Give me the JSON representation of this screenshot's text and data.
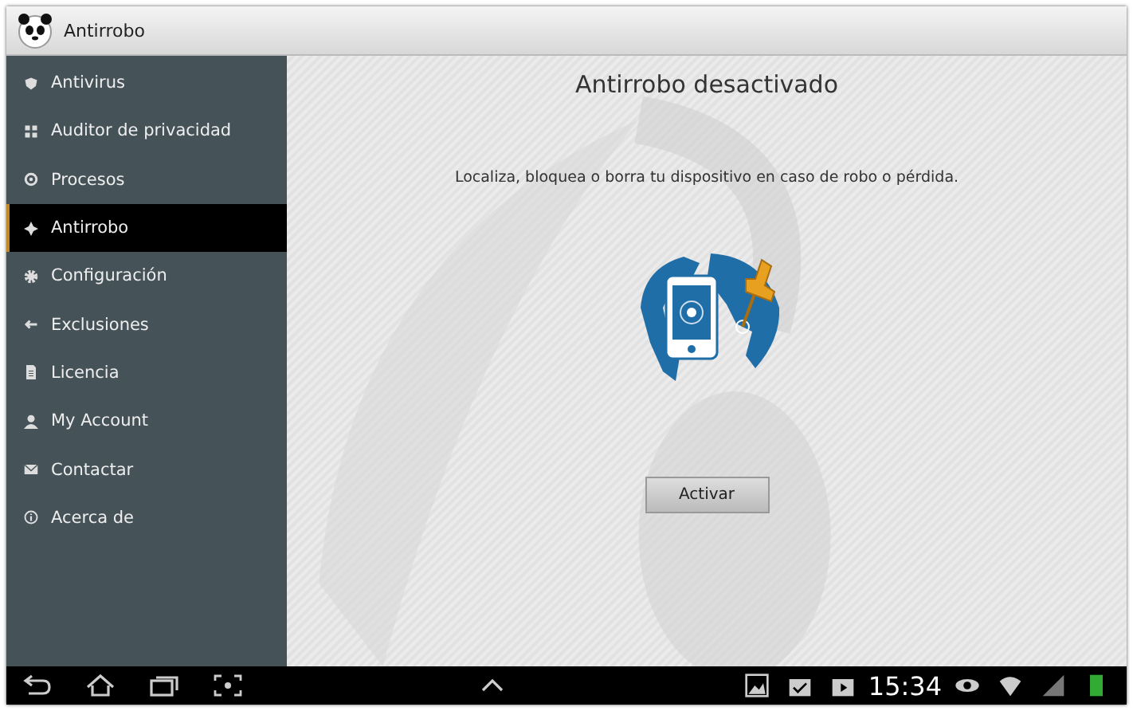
{
  "app_bar": {
    "title": "Antirrobo"
  },
  "sidebar": {
    "items": [
      {
        "label": "Antivirus",
        "selected": false
      },
      {
        "label": "Auditor de privacidad",
        "selected": false
      },
      {
        "label": "Procesos",
        "selected": false
      },
      {
        "label": "Antirrobo",
        "selected": true
      },
      {
        "label": "Configuración",
        "selected": false
      },
      {
        "label": "Exclusiones",
        "selected": false
      },
      {
        "label": "Licencia",
        "selected": false
      },
      {
        "label": "My Account",
        "selected": false
      },
      {
        "label": "Contactar",
        "selected": false
      },
      {
        "label": "Acerca de",
        "selected": false
      }
    ]
  },
  "content": {
    "title": "Antirrobo desactivado",
    "description": "Localiza, bloquea o borra tu dispositivo en caso de robo o pérdida.",
    "button": "Activar"
  },
  "status_bar": {
    "time": "15:34"
  }
}
